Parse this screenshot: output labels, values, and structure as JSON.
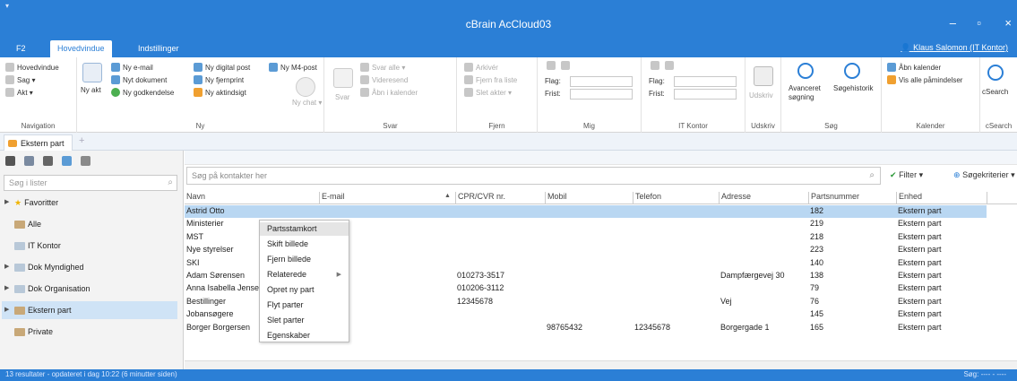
{
  "window": {
    "title": "cBrain AcCloud03",
    "qat_icon": "menu-icon",
    "minimize_glyph": "–",
    "maximize_glyph": "▫",
    "close_glyph": "×"
  },
  "tabs": {
    "f2": "F2",
    "home": "Hovedvindue",
    "settings": "Indstillinger"
  },
  "user": "Klaus Salomon (IT Kontor)",
  "ribbon": {
    "navigation": {
      "items": [
        "Hovedvindue",
        "Sag ▾",
        "Akt ▾"
      ],
      "label": "Navigation"
    },
    "ny": {
      "big_label": "Ny akt",
      "items": [
        "Ny e-mail",
        "Nyt dokument",
        "Ny godkendelse",
        "Ny digital post",
        "Ny fjernprint",
        "Ny aktindsigt",
        "Ny M4-post"
      ],
      "chat_label": "Ny chat ▾",
      "label": "Ny"
    },
    "svar": {
      "big_label": "Svar",
      "items": [
        "Svar alle ▾",
        "Videresend",
        "Åbn i kalender"
      ],
      "label": "Svar"
    },
    "fjern": {
      "items": [
        "Arkivér",
        "Fjern fra liste",
        "Slet akter ▾"
      ],
      "label": "Fjern"
    },
    "mig": {
      "flag_label": "Flag:",
      "frist_label": "Frist:",
      "label": "Mig"
    },
    "it_kontor": {
      "flag_label": "Flag:",
      "frist_label": "Frist:",
      "label": "IT Kontor"
    },
    "udskriv": {
      "big_label": "Udskriv",
      "label": "Udskriv"
    },
    "sog": {
      "advanced": "Avanceret søgning",
      "history": "Søgehistorik",
      "label": "Søg"
    },
    "kalender": {
      "open": "Åbn kalender",
      "reminders": "Vis alle påmindelser",
      "label": "Kalender"
    },
    "csearch": {
      "big_label": "cSearch",
      "label": "cSearch"
    }
  },
  "doc_tab": "Ekstern part",
  "left_panel": {
    "search_placeholder": "Søg i lister",
    "tree": [
      "Favoritter",
      "Alle",
      "IT Kontor",
      "Dok Myndighed",
      "Dok Organisation",
      "Ekstern part",
      "Private"
    ]
  },
  "main": {
    "search_placeholder": "Søg på kontakter her",
    "filter_label": "Filter ▾",
    "criteria_label": "Søgekriterier ▾",
    "columns": [
      "Navn",
      "E-mail",
      "CPR/CVR nr.",
      "Mobil",
      "Telefon",
      "Adresse",
      "Partsnummer",
      "Enhed"
    ],
    "rows": [
      {
        "navn": "Astrid Otto",
        "email": "",
        "cpr": "",
        "mobil": "",
        "telefon": "",
        "adresse": "",
        "nr": "182",
        "enhed": "Ekstern part"
      },
      {
        "navn": "Ministerier",
        "email": "",
        "cpr": "",
        "mobil": "",
        "telefon": "",
        "adresse": "",
        "nr": "219",
        "enhed": "Ekstern part"
      },
      {
        "navn": "MST",
        "email": "",
        "cpr": "",
        "mobil": "",
        "telefon": "",
        "adresse": "",
        "nr": "218",
        "enhed": "Ekstern part"
      },
      {
        "navn": "Nye styrelser",
        "email": "",
        "cpr": "",
        "mobil": "",
        "telefon": "",
        "adresse": "",
        "nr": "223",
        "enhed": "Ekstern part"
      },
      {
        "navn": "SKI",
        "email": "",
        "cpr": "",
        "mobil": "",
        "telefon": "",
        "adresse": "",
        "nr": "140",
        "enhed": "Ekstern part"
      },
      {
        "navn": "Adam Sørensen",
        "email": "",
        "cpr": "010273-3517",
        "mobil": "",
        "telefon": "",
        "adresse": "Dampfærgevej 30",
        "nr": "138",
        "enhed": "Ekstern part"
      },
      {
        "navn": "Anna Isabella Jensen",
        "email": "",
        "cpr": "010206-3112",
        "mobil": "",
        "telefon": "",
        "adresse": "",
        "nr": "79",
        "enhed": "Ekstern part"
      },
      {
        "navn": "Bestillinger",
        "email": "",
        "cpr": "12345678",
        "mobil": "",
        "telefon": "",
        "adresse": "Vej",
        "nr": "76",
        "enhed": "Ekstern part"
      },
      {
        "navn": "Jobansøgere",
        "email": "",
        "cpr": "",
        "mobil": "",
        "telefon": "",
        "adresse": "",
        "nr": "145",
        "enhed": "Ekstern part"
      },
      {
        "navn": "Borger Borgersen",
        "email": "",
        "cpr": "",
        "mobil": "98765432",
        "telefon": "12345678",
        "adresse": "Borgergade 1",
        "nr": "165",
        "enhed": "Ekstern part"
      }
    ]
  },
  "context_menu": [
    "Partsstamkort",
    "Skift billede",
    "Fjern billede",
    "Relaterede",
    "Opret ny part",
    "Flyt parter",
    "Slet parter",
    "Egenskaber"
  ],
  "status": {
    "left": "13 resultater - opdateret i dag 10:22 (6 minutter siden)",
    "right": "Søg: ---- - ----"
  },
  "colors": {
    "accent": "#2b7fd6",
    "selection": "#b9d7f2"
  }
}
